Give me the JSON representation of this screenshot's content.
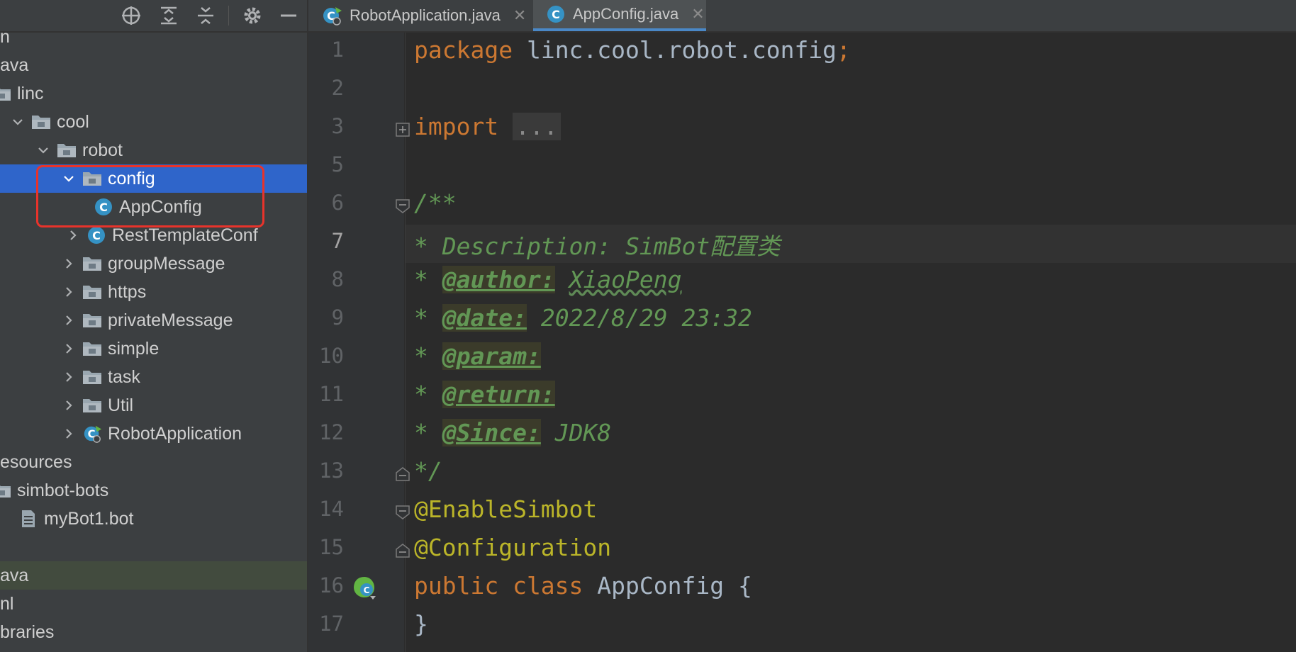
{
  "project_tree": {
    "toolbar": {
      "icons": [
        "locate-icon",
        "expand-all-icon",
        "collapse-all-icon",
        "gear-icon",
        "minimize-icon"
      ]
    },
    "rows": [
      {
        "label": "n",
        "type": "text",
        "depth": 0
      },
      {
        "label": "ava",
        "type": "text",
        "depth": 0
      },
      {
        "label": "linc",
        "type": "folder",
        "depth": 0
      },
      {
        "label": "cool",
        "type": "folder",
        "depth": 1,
        "expanded": true
      },
      {
        "label": "robot",
        "type": "folder",
        "depth": 2,
        "expanded": true
      },
      {
        "label": "config",
        "type": "folder",
        "depth": 3,
        "expanded": true,
        "selected": true
      },
      {
        "label": "AppConfig",
        "type": "class",
        "depth": 4
      },
      {
        "label": "RestTemplateConf",
        "type": "class",
        "depth": 4,
        "expanded": false
      },
      {
        "label": "groupMessage",
        "type": "folder",
        "depth": 3,
        "expanded": false
      },
      {
        "label": "https",
        "type": "folder",
        "depth": 3,
        "expanded": false
      },
      {
        "label": "privateMessage",
        "type": "folder",
        "depth": 3,
        "expanded": false
      },
      {
        "label": "simple",
        "type": "folder",
        "depth": 3,
        "expanded": false
      },
      {
        "label": "task",
        "type": "folder",
        "depth": 3,
        "expanded": false
      },
      {
        "label": "Util",
        "type": "folder",
        "depth": 3,
        "expanded": false
      },
      {
        "label": "RobotApplication",
        "type": "springclass",
        "depth": 3,
        "expanded": false
      },
      {
        "label": "esources",
        "type": "text",
        "depth": 0
      },
      {
        "label": "simbot-bots",
        "type": "folder",
        "depth": 0
      },
      {
        "label": "myBot1.bot",
        "type": "file",
        "depth": 1
      },
      {
        "label": "",
        "type": "blank",
        "depth": 0
      },
      {
        "label": "ava",
        "type": "text",
        "depth": 0,
        "highlighted": true
      },
      {
        "label": "nl",
        "type": "text",
        "depth": 0
      },
      {
        "label": "braries",
        "type": "text",
        "depth": 0
      }
    ]
  },
  "tabs": [
    {
      "label": "RobotApplication.java",
      "icon": "spring-class-icon",
      "active": false
    },
    {
      "label": "AppConfig.java",
      "icon": "class-icon",
      "active": true
    }
  ],
  "editor": {
    "current_line": 7,
    "lines": [
      {
        "num": "1",
        "tokens": [
          {
            "t": "package ",
            "c": "kw"
          },
          {
            "t": "linc.cool.robot.config",
            "c": "pkg"
          },
          {
            "t": ";",
            "c": "sc"
          }
        ]
      },
      {
        "num": "2",
        "tokens": []
      },
      {
        "num": "3",
        "tokens": [
          {
            "t": "import ",
            "c": "kw"
          },
          {
            "t": "...",
            "c": "fold-box"
          }
        ],
        "fold": "plus"
      },
      {
        "num": "5",
        "tokens": []
      },
      {
        "num": "6",
        "tokens": [
          {
            "t": "/**",
            "c": "doc"
          }
        ],
        "fold": "open"
      },
      {
        "num": "7",
        "tokens": [
          {
            "t": "* Description: SimBot配置类",
            "c": "doc"
          }
        ]
      },
      {
        "num": "8",
        "tokens": [
          {
            "t": "* ",
            "c": "doc"
          },
          {
            "t": "@author:",
            "c": "tag"
          },
          {
            "t": " ",
            "c": "doc"
          },
          {
            "t": "XiaoPeng",
            "c": "docv wavy"
          }
        ]
      },
      {
        "num": "9",
        "tokens": [
          {
            "t": "* ",
            "c": "doc"
          },
          {
            "t": "@date:",
            "c": "tag"
          },
          {
            "t": " 2022/8/29 23:32",
            "c": "docv"
          }
        ]
      },
      {
        "num": "10",
        "tokens": [
          {
            "t": "* ",
            "c": "doc"
          },
          {
            "t": "@param:",
            "c": "tag"
          }
        ]
      },
      {
        "num": "11",
        "tokens": [
          {
            "t": "* ",
            "c": "doc"
          },
          {
            "t": "@return:",
            "c": "tag"
          }
        ]
      },
      {
        "num": "12",
        "tokens": [
          {
            "t": "* ",
            "c": "doc"
          },
          {
            "t": "@Since:",
            "c": "tag"
          },
          {
            "t": " JDK8",
            "c": "docv"
          }
        ]
      },
      {
        "num": "13",
        "tokens": [
          {
            "t": "*/",
            "c": "doc"
          }
        ],
        "fold": "close"
      },
      {
        "num": "14",
        "tokens": [
          {
            "t": "@EnableSimbot",
            "c": "ann"
          }
        ],
        "fold": "open"
      },
      {
        "num": "15",
        "tokens": [
          {
            "t": "@Configuration",
            "c": "ann"
          }
        ],
        "fold": "close"
      },
      {
        "num": "16",
        "tokens": [
          {
            "t": "public class ",
            "c": "kw"
          },
          {
            "t": "AppConfig {",
            "c": "pkg"
          }
        ],
        "gutter_icon": "spring-bean-icon"
      },
      {
        "num": "17",
        "tokens": [
          {
            "t": "}",
            "c": "pkg"
          }
        ]
      }
    ]
  },
  "colors": {
    "selection": "#2f65ca",
    "highlight_box": "#e8332b",
    "keyword": "#cc7832",
    "annotation": "#bbb529",
    "doc_comment": "#629755"
  }
}
